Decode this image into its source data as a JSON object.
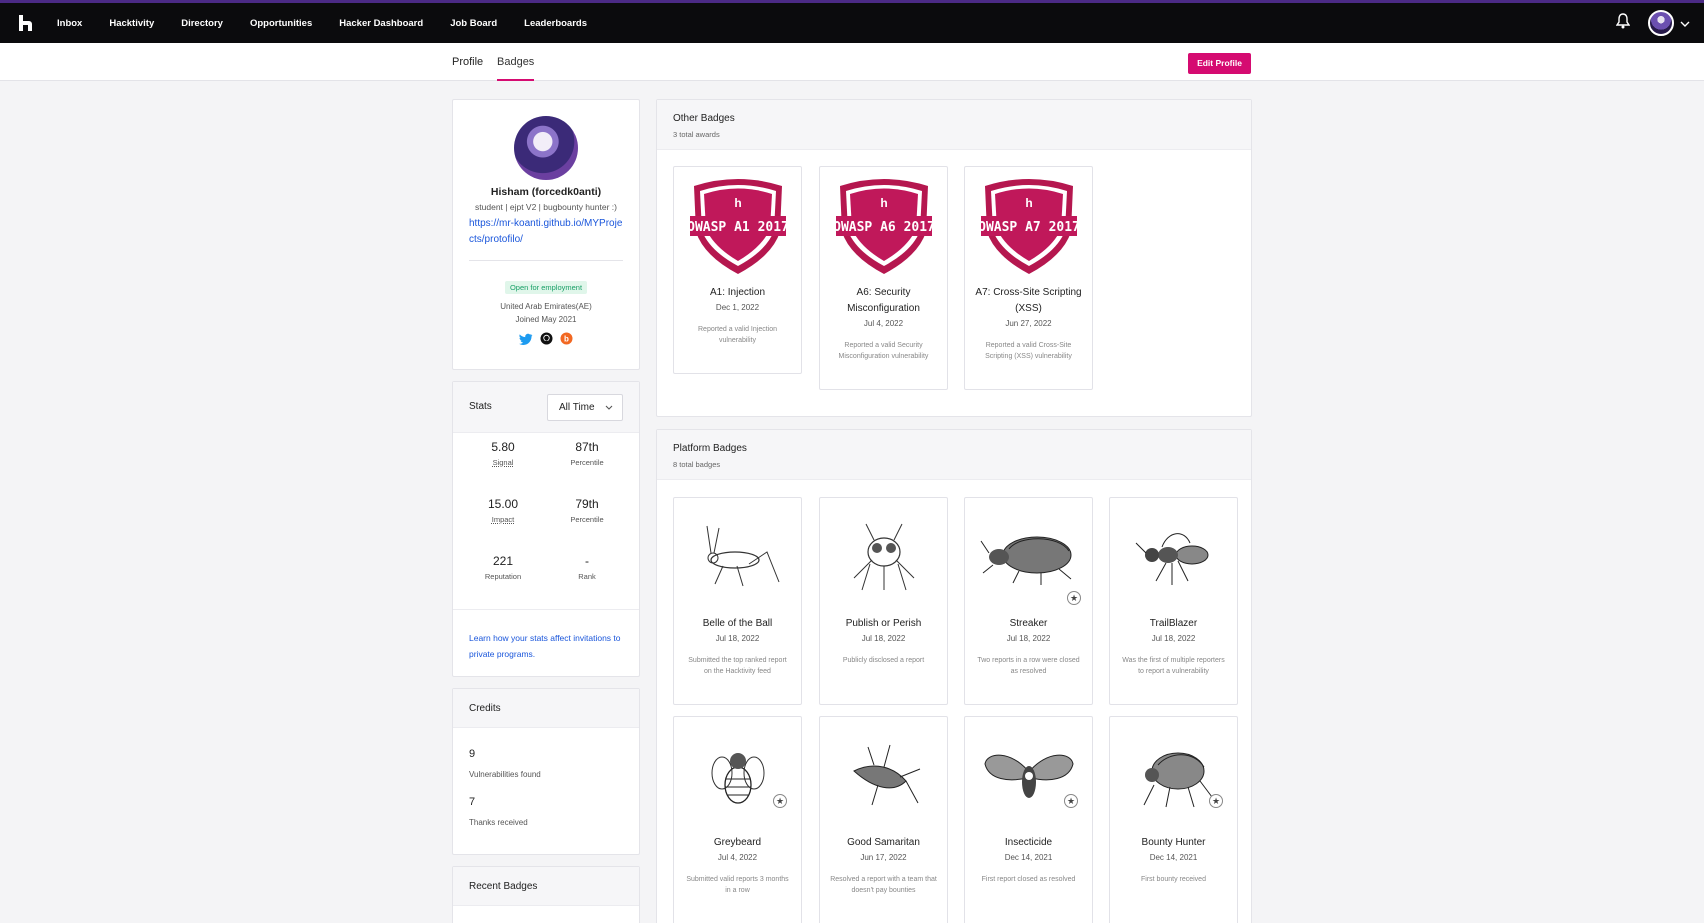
{
  "nav": {
    "links": [
      "Inbox",
      "Hacktivity",
      "Directory",
      "Opportunities",
      "Hacker Dashboard",
      "Job Board",
      "Leaderboards"
    ],
    "icons": [
      "hackerone-logo-icon",
      "bell-icon",
      "user-avatar",
      "chevron-down-icon"
    ]
  },
  "tabs": {
    "profile": "Profile",
    "badges": "Badges"
  },
  "edit_profile": "Edit Profile",
  "profile": {
    "name": "Hisham (forcedk0anti)",
    "bio": "student | ejpt V2 | bugbounty hunter :)",
    "website": "https://mr-koanti.github.io/MYProjects/protofilo/",
    "employment": "Open for employment",
    "location": "United Arab Emirates(AE)",
    "joined": "Joined May 2021",
    "socials": [
      "twitter-icon",
      "github-icon",
      "bugcrowd-icon"
    ]
  },
  "stats": {
    "title": "Stats",
    "period": "All Time",
    "items": [
      {
        "value": "5.80",
        "label": "Signal"
      },
      {
        "value": "87th",
        "label": "Percentile"
      },
      {
        "value": "15.00",
        "label": "Impact"
      },
      {
        "value": "79th",
        "label": "Percentile"
      },
      {
        "value": "221",
        "label": "Reputation"
      },
      {
        "value": "-",
        "label": "Rank"
      }
    ],
    "learn_link": "Learn how your stats affect invitations to private programs."
  },
  "credits": {
    "title": "Credits",
    "vulns_count": "9",
    "vulns_label": "Vulnerabilities found",
    "thanks_count": "7",
    "thanks_label": "Thanks received"
  },
  "recent_badges": {
    "title": "Recent Badges"
  },
  "other_badges": {
    "title": "Other Badges",
    "subtitle": "3 total awards",
    "items": [
      {
        "shield": "OWASP A1 2017",
        "name": "A1: Injection",
        "date": "Dec 1, 2022",
        "desc": "Reported a valid Injection vulnerability"
      },
      {
        "shield": "OWASP A6 2017",
        "name": "A6: Security Misconfiguration",
        "date": "Jul 4, 2022",
        "desc": "Reported a valid Security Misconfiguration vulnerability"
      },
      {
        "shield": "OWASP A7 2017",
        "name": "A7: Cross-Site Scripting (XSS)",
        "date": "Jun 27, 2022",
        "desc": "Reported a valid Cross-Site Scripting (XSS) vulnerability"
      }
    ]
  },
  "platform_badges": {
    "title": "Platform Badges",
    "subtitle": "8 total badges",
    "items": [
      {
        "name": "Belle of the Ball",
        "date": "Jul 18, 2022",
        "desc": "Submitted the top ranked report on the Hacktivity feed",
        "art": "cricket-icon"
      },
      {
        "name": "Publish or Perish",
        "date": "Jul 18, 2022",
        "desc": "Publicly disclosed a report",
        "art": "fly-icon"
      },
      {
        "name": "Streaker",
        "date": "Jul 18, 2022",
        "desc": "Two reports in a row were closed as resolved",
        "art": "beetle-icon"
      },
      {
        "name": "TrailBlazer",
        "date": "Jul 18, 2022",
        "desc": "Was the first of multiple reporters to report a vulnerability",
        "art": "wasp-icon"
      },
      {
        "name": "Greybeard",
        "date": "Jul 4, 2022",
        "desc": "Submitted valid reports 3 months in a row",
        "art": "bee-icon"
      },
      {
        "name": "Good Samaritan",
        "date": "Jun 17, 2022",
        "desc": "Resolved a report with a team that doesn't pay bounties",
        "art": "firefly-icon"
      },
      {
        "name": "Insecticide",
        "date": "Dec 14, 2021",
        "desc": "First report closed as resolved",
        "art": "moth-icon"
      },
      {
        "name": "Bounty Hunter",
        "date": "Dec 14, 2021",
        "desc": "First bounty received",
        "art": "scarab-icon"
      }
    ]
  },
  "colors": {
    "brand": "#d50b71",
    "nav_bg": "#0b0b0d",
    "link": "#1a56db",
    "employment_green": "#19a067"
  }
}
